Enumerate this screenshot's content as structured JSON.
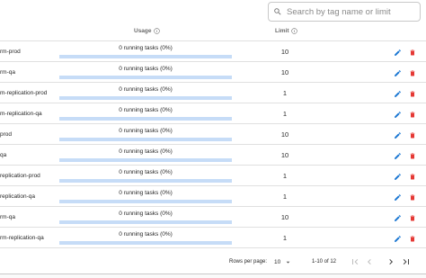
{
  "search": {
    "placeholder": "Search by tag name or limit"
  },
  "table": {
    "headers": {
      "usage": "Usage",
      "limit": "Limit"
    },
    "rows": [
      {
        "name": "rm-prod",
        "usage_text": "0 running tasks (0%)",
        "usage_fraction": 0,
        "limit": "10"
      },
      {
        "name": "rm-qa",
        "usage_text": "0 running tasks (0%)",
        "usage_fraction": 0,
        "limit": "10"
      },
      {
        "name": "m-replication-prod",
        "usage_text": "0 running tasks (0%)",
        "usage_fraction": 0,
        "limit": "1"
      },
      {
        "name": "m-replication-qa",
        "usage_text": "0 running tasks (0%)",
        "usage_fraction": 0,
        "limit": "1"
      },
      {
        "name": "prod",
        "usage_text": "0 running tasks (0%)",
        "usage_fraction": 0,
        "limit": "10"
      },
      {
        "name": "qa",
        "usage_text": "0 running tasks (0%)",
        "usage_fraction": 0,
        "limit": "10"
      },
      {
        "name": "replication-prod",
        "usage_text": "0 running tasks (0%)",
        "usage_fraction": 0,
        "limit": "1"
      },
      {
        "name": "replication-qa",
        "usage_text": "0 running tasks (0%)",
        "usage_fraction": 0,
        "limit": "1"
      },
      {
        "name": "rm-qa",
        "usage_text": "0 running tasks (0%)",
        "usage_fraction": 0,
        "limit": "10"
      },
      {
        "name": "rm-replication-qa",
        "usage_text": "0 running tasks (0%)",
        "usage_fraction": 0,
        "limit": "1"
      }
    ]
  },
  "pagination": {
    "rows_per_page_label": "Rows per page:",
    "rows_per_page_value": "10",
    "range_label": "1-10 of 12"
  },
  "icons": {
    "search": "search-icon",
    "info": "info-icon",
    "edit": "pencil-icon",
    "delete": "trash-icon",
    "first_page": "first-page-icon",
    "prev_page": "chevron-left-icon",
    "next_page": "chevron-right-icon",
    "last_page": "last-page-icon",
    "dropdown": "dropdown-arrow-icon"
  },
  "colors": {
    "edit": "#1976d2",
    "delete": "#e53935",
    "bar_track": "#c6dcf7",
    "bar_fill": "#1976d2"
  }
}
